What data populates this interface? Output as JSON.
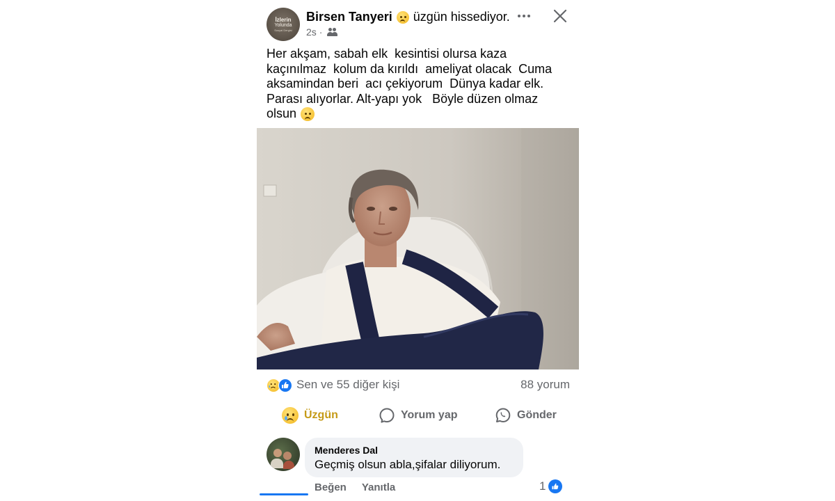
{
  "post": {
    "avatar_text": [
      "İzlerin",
      "Yolunda",
      "Sosyal Dergisi"
    ],
    "author": "Birsen Tanyeri",
    "feeling": "üzgün hissediyor.",
    "time": "2s",
    "separator": "·",
    "audience_icon": "friends-icon",
    "text_lines": [
      "Her akşam, sabah elk  kesintisi olursa kaza",
      "kaçınılmaz  kolum da kırıldı  ameliyat olacak  Cuma",
      "aksamindan beri  acı çekiyorum  Dünya kadar elk.",
      "Parası alıyorlar. Alt-yapı yok   Böyle düzen olmaz",
      "olsun"
    ]
  },
  "reactions": {
    "icons": [
      "sad-reaction-icon",
      "like-reaction-icon"
    ],
    "summary": "Sen ve 55 diğer kişi",
    "comments": "88 yorum"
  },
  "actions": {
    "react_label": "Üzgün",
    "comment_label": "Yorum yap",
    "share_label": "Gönder"
  },
  "comment": {
    "author": "Menderes Dal",
    "text": "Geçmiş olsun abla,şifalar diliyorum.",
    "like_label": "Beğen",
    "reply_label": "Yanıtla",
    "like_count": "1"
  },
  "colors": {
    "accent": "#1877f2",
    "sad_active": "#c59a16",
    "secondary_text": "#65676b",
    "bubble_bg": "#f0f2f5"
  }
}
